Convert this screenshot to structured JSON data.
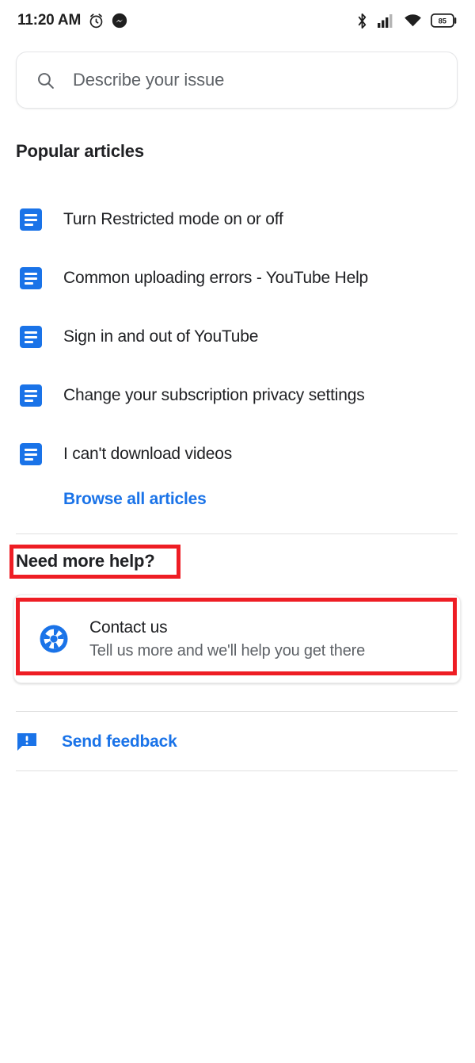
{
  "status_bar": {
    "time": "11:20 AM",
    "left_icons": [
      "alarm-clock-icon",
      "messenger-icon"
    ],
    "right_icons": [
      "bluetooth-icon",
      "cellular-signal-icon",
      "wifi-icon",
      "battery-icon"
    ],
    "battery_level": "85"
  },
  "search": {
    "placeholder": "Describe your issue",
    "icon": "search-icon",
    "value": ""
  },
  "popular": {
    "heading": "Popular articles",
    "articles": [
      {
        "label": "Turn Restricted mode on or off",
        "icon": "article-icon"
      },
      {
        "label": "Common uploading errors - YouTube Help",
        "icon": "article-icon"
      },
      {
        "label": "Sign in and out of YouTube",
        "icon": "article-icon"
      },
      {
        "label": "Change your subscription privacy settings",
        "icon": "article-icon"
      },
      {
        "label": "I can't download videos",
        "icon": "article-icon"
      }
    ],
    "browse_all_label": "Browse all articles"
  },
  "need_more_help": {
    "heading": "Need more help?",
    "contact": {
      "title": "Contact us",
      "subtitle": "Tell us more and we'll help you get there",
      "icon": "support-wheel-icon"
    }
  },
  "feedback": {
    "label": "Send feedback",
    "icon": "feedback-bubble-icon"
  },
  "colors": {
    "accent_blue": "#1a73e8",
    "text_primary": "#202124",
    "text_secondary": "#5f6368",
    "annotation_red": "#ee1d24",
    "divider": "#e0e0e0"
  }
}
